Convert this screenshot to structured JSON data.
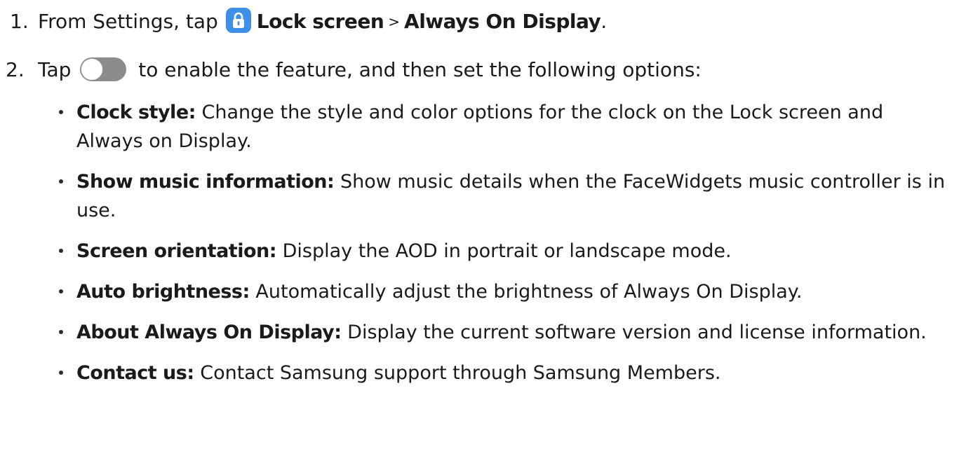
{
  "steps": [
    {
      "number": "1.",
      "prefix": "From Settings, tap ",
      "icon": "lock-screen-settings-icon",
      "item1": "Lock screen",
      "separator": ">",
      "item2": "Always On Display",
      "suffix": "."
    },
    {
      "number": "2.",
      "prefix": "Tap ",
      "icon": "toggle-switch-icon",
      "suffix": " to enable the feature, and then set the following options:"
    }
  ],
  "options": [
    {
      "title": "Clock style",
      "desc": "Change the style and color options for the clock on the Lock screen and Always on Display."
    },
    {
      "title": "Show music information",
      "desc": "Show music details when the FaceWidgets music controller is in use."
    },
    {
      "title": "Screen orientation",
      "desc": "Display the AOD in portrait or landscape mode."
    },
    {
      "title": "Auto brightness",
      "desc": "Automatically adjust the brightness of Always On Display."
    },
    {
      "title": "About Always On Display",
      "desc": "Display the current software version and license information."
    },
    {
      "title": "Contact us",
      "desc": "Contact Samsung support through Samsung Members."
    }
  ],
  "colors": {
    "lock_icon_bg": "#3d8fe8",
    "toggle_track": "#8c8c8c",
    "text": "#1a1a1a"
  }
}
